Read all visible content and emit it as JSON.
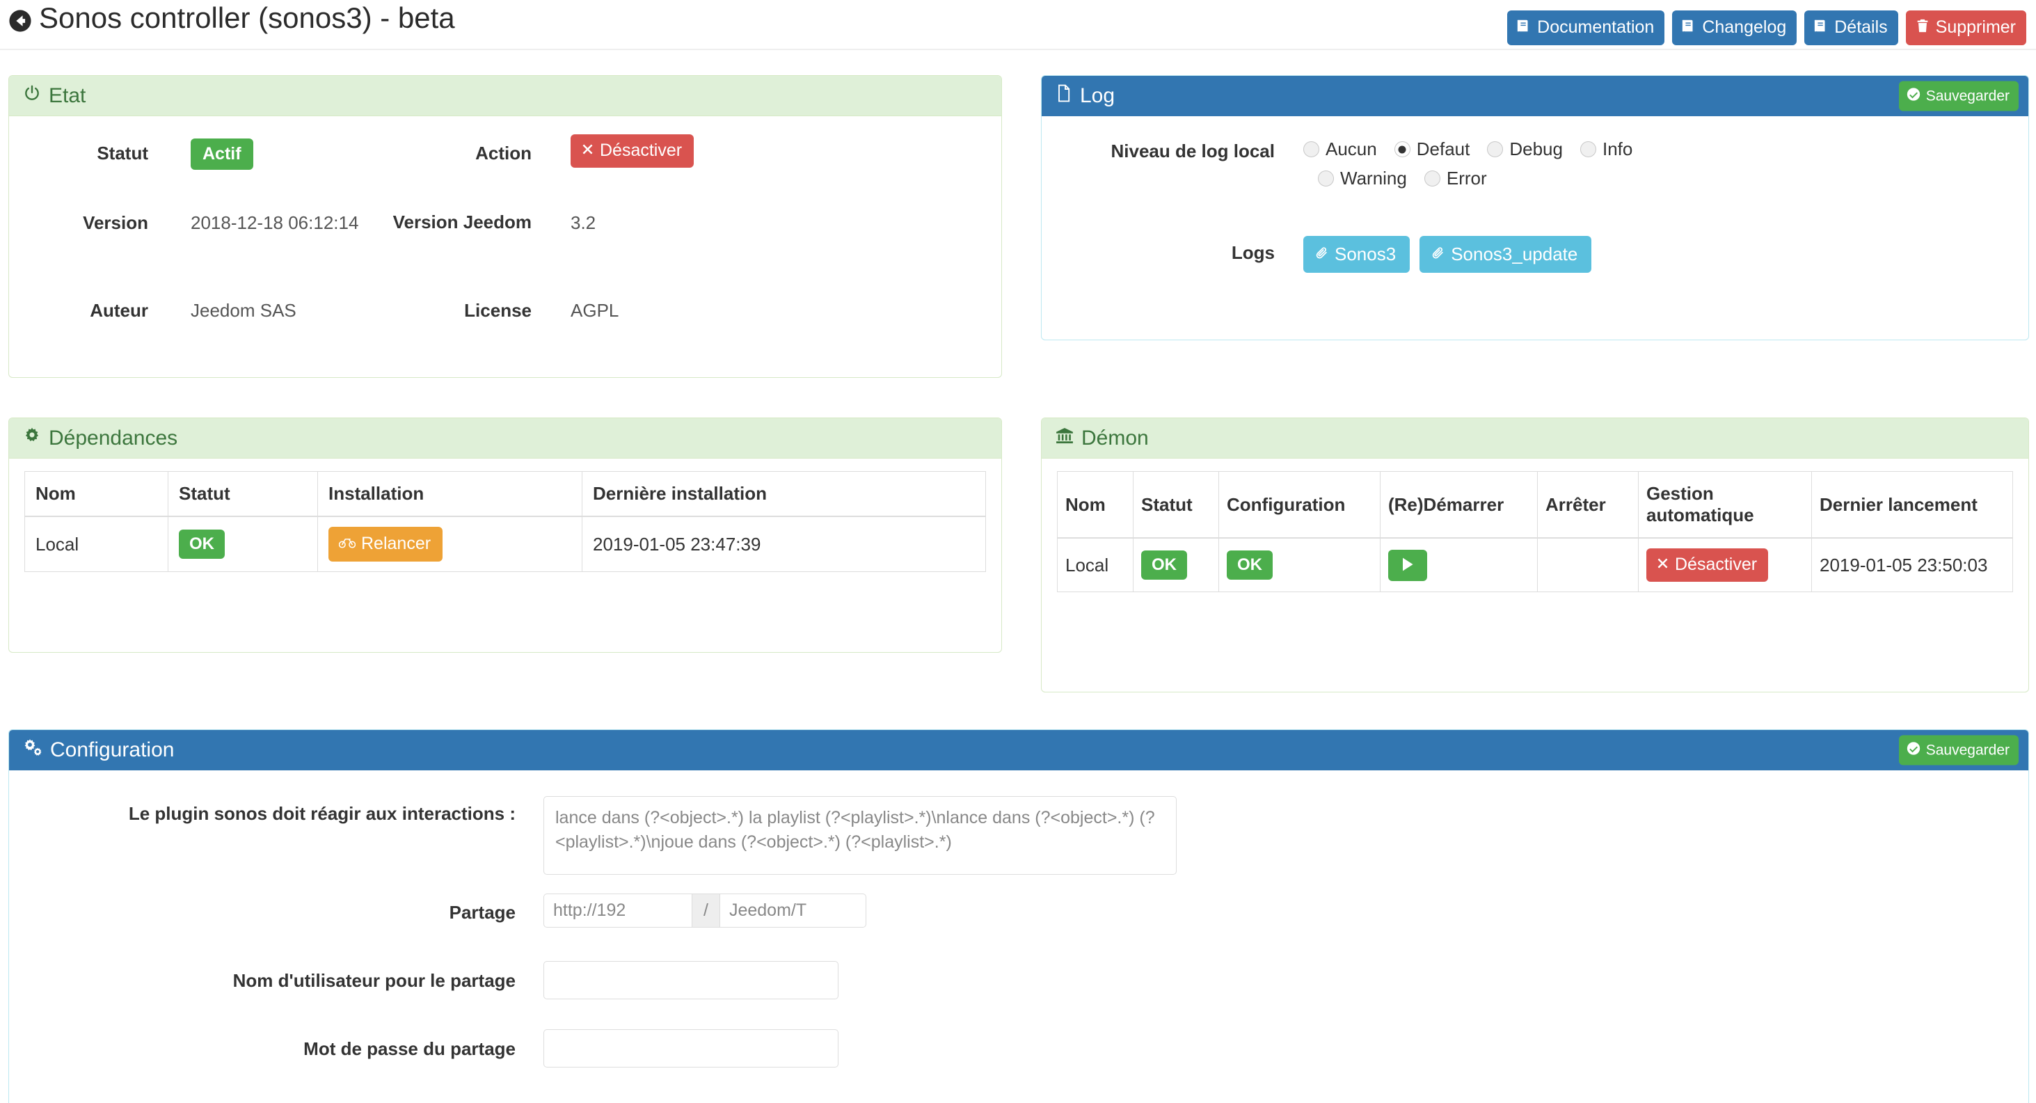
{
  "header": {
    "title": "Sonos controller (sonos3) - beta",
    "back_icon": "back-circle-icon",
    "buttons": [
      {
        "label": "Documentation",
        "icon": "book-icon",
        "style": "primary"
      },
      {
        "label": "Changelog",
        "icon": "book-icon",
        "style": "primary"
      },
      {
        "label": "Détails",
        "icon": "book-icon",
        "style": "primary"
      },
      {
        "label": "Supprimer",
        "icon": "trash-icon",
        "style": "danger"
      }
    ]
  },
  "etat": {
    "title": "Etat",
    "icon": "power-icon",
    "labels": {
      "statut": "Statut",
      "version": "Version",
      "auteur": "Auteur",
      "action": "Action",
      "version_jeedom": "Version Jeedom",
      "license": "License"
    },
    "statut_badge": "Actif",
    "version": "2018-12-18 06:12:14",
    "auteur": "Jeedom SAS",
    "action_button": "Désactiver",
    "action_icon": "x-icon",
    "version_jeedom": "3.2",
    "license": "AGPL"
  },
  "log": {
    "title": "Log",
    "icon": "file-icon",
    "save_label": "Sauvegarder",
    "save_icon": "check-circle-icon",
    "niveau_label": "Niveau de log local",
    "levels": [
      {
        "label": "Aucun",
        "selected": false
      },
      {
        "label": "Defaut",
        "selected": true
      },
      {
        "label": "Debug",
        "selected": false
      },
      {
        "label": "Info",
        "selected": false
      },
      {
        "label": "Warning",
        "selected": false
      },
      {
        "label": "Error",
        "selected": false
      }
    ],
    "logs_label": "Logs",
    "log_buttons": [
      {
        "label": "Sonos3",
        "icon": "paperclip-icon"
      },
      {
        "label": "Sonos3_update",
        "icon": "paperclip-icon"
      }
    ]
  },
  "dependances": {
    "title": "Dépendances",
    "icon": "cog-icon",
    "columns": [
      "Nom",
      "Statut",
      "Installation",
      "Dernière installation"
    ],
    "rows": [
      {
        "nom": "Local",
        "statut": "OK",
        "installation_button": "Relancer",
        "installation_icon": "bicycle-icon",
        "derniere_installation": "2019-01-05 23:47:39"
      }
    ]
  },
  "demon": {
    "title": "Démon",
    "icon": "bank-icon",
    "columns": [
      "Nom",
      "Statut",
      "Configuration",
      "(Re)Démarrer",
      "Arrêter",
      "Gestion automatique",
      "Dernier lancement"
    ],
    "rows": [
      {
        "nom": "Local",
        "statut": "OK",
        "configuration": "OK",
        "redemarrer_icon": "play-icon",
        "arreter": "",
        "gestion_button": "Désactiver",
        "gestion_icon": "x-icon",
        "dernier_lancement": "2019-01-05 23:50:03"
      }
    ]
  },
  "configuration": {
    "title": "Configuration",
    "icon": "cogs-icon",
    "save_label": "Sauvegarder",
    "save_icon": "check-circle-icon",
    "fields": {
      "interactions_label": "Le plugin sonos doit réagir aux interactions :",
      "interactions_value": "lance dans (?<object>.*) la playlist (?<playlist>.*)\\nlance dans (?<object>.*) (?<playlist>.*)\\njoue dans (?<object>.*) (?<playlist>.*)",
      "partage_label": "Partage",
      "partage_host": "http://192",
      "partage_separator": "/",
      "partage_path": "Jeedom/T",
      "username_label": "Nom d'utilisateur pour le partage",
      "username_value": "",
      "password_label": "Mot de passe du partage",
      "password_value": ""
    }
  },
  "colors": {
    "primary": "#3276b1",
    "success": "#4cae4c",
    "danger": "#d9534f",
    "info": "#5bc0de",
    "warning": "#eea236",
    "panel_green_bg": "#dff0d8",
    "panel_green_text": "#3c763d"
  }
}
